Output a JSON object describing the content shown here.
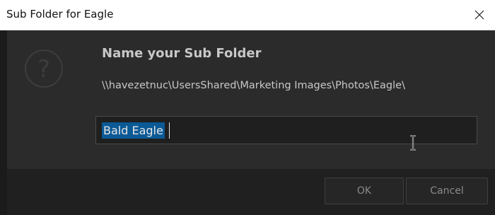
{
  "window": {
    "title": "Sub Folder for Eagle"
  },
  "dialog": {
    "icon": "question-circle-icon",
    "heading": "Name your Sub Folder",
    "path": "\\\\havezetnuc\\UsersShared\\Marketing Images\\Photos\\Eagle\\",
    "input_value": "Bald Eagle",
    "input_selected": true
  },
  "buttons": {
    "ok_label": "OK",
    "cancel_label": "Cancel"
  },
  "colors": {
    "dialog_bg": "#2b2b2b",
    "footer_bg": "#202020",
    "selection": "#0b5a96",
    "titlebar_bg": "#ffffff"
  }
}
